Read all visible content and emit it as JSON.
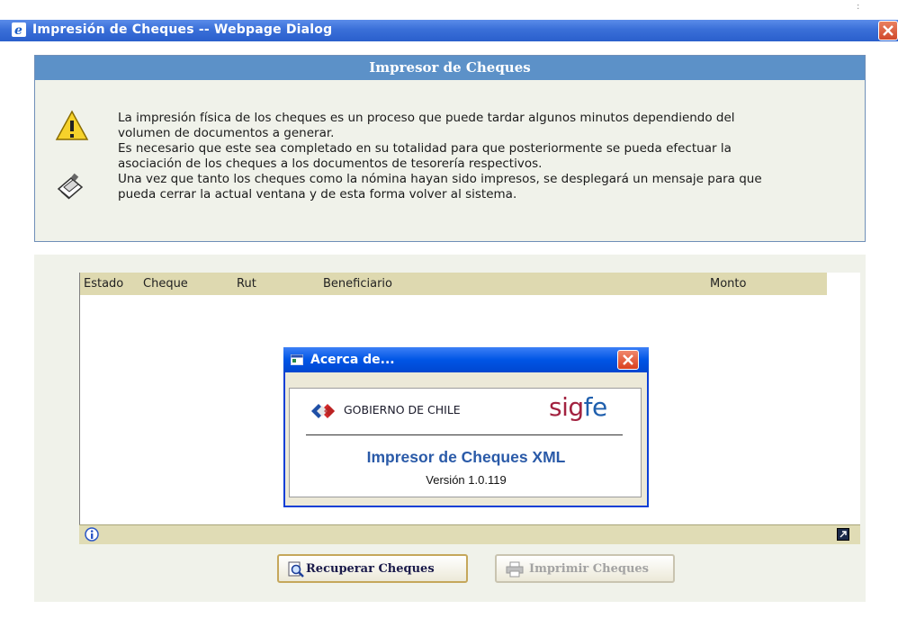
{
  "window": {
    "title": "Impresión de Cheques -- Webpage Dialog"
  },
  "header": {
    "title": "Impresor de Cheques",
    "paragraph_lines": [
      "La impresión física de los cheques es un proceso que puede tardar algunos minutos dependiendo del",
      "volumen de documentos a generar.",
      "Es necesario que este sea completado en su totalidad para que posteriormente se pueda efectuar la",
      "asociación de los cheques a los documentos de tesorería respectivos.",
      "Una vez que tanto los cheques como la nómina hayan sido impresos, se desplegará un mensaje para que",
      "pueda cerrar la actual ventana y de esta forma volver al sistema."
    ]
  },
  "grid": {
    "columns": [
      "Estado",
      "Cheque",
      "Rut",
      "Beneficiario",
      "Monto"
    ],
    "rows": []
  },
  "buttons": {
    "recuperar": "Recuperar Cheques",
    "imprimir": "Imprimir Cheques"
  },
  "about": {
    "title": "Acerca de...",
    "org": "GOBIERNO DE CHILE",
    "logo_a": "sig",
    "logo_b": "fe",
    "product": "Impresor de Cheques XML",
    "version": "Versión 1.0.119"
  },
  "icons": {
    "window": "ie-icon",
    "warning": "warning-icon",
    "cheque": "cheque-printer-icon",
    "info": "info-icon",
    "expand": "expand-icon",
    "search": "magnifier-icon",
    "printer": "printer-icon"
  },
  "colors": {
    "titlebar": "#3a6fd8",
    "header_bar": "#5c91c8",
    "panel": "#f0f2ea",
    "grid_header": "#ded9b0",
    "about_title": "#0055e5",
    "product_text": "#2a5aa8"
  }
}
